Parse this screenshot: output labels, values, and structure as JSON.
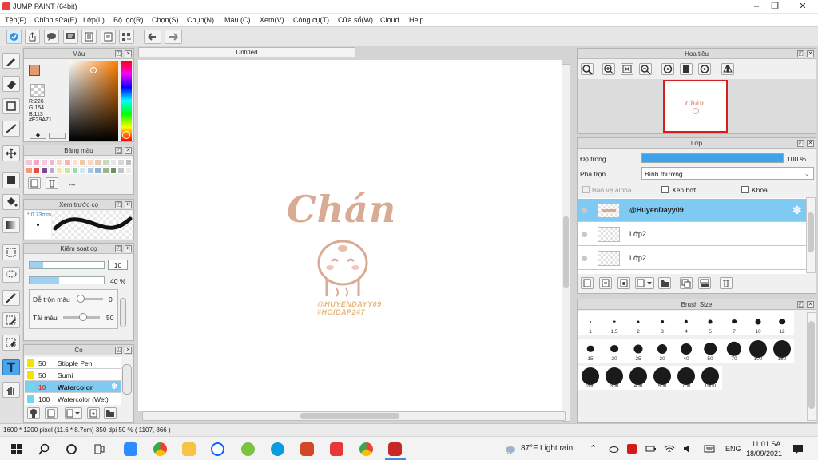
{
  "window": {
    "title": "JUMP PAINT (64bit)"
  },
  "menu": [
    "Tệp(F)",
    "Chỉnh sửa(E)",
    "Lớp(L)",
    "Bộ lọc(R)",
    "Chọn(S)",
    "Chụp(N)",
    "Màu (C)",
    "Xem(V)",
    "Công cụ(T)",
    "Cửa sổ(W)",
    "Cloud",
    "Help"
  ],
  "document": {
    "tab": "Untitled"
  },
  "color_panel": {
    "title": "Màu",
    "r": "R:226",
    "g": "G:154",
    "b": "B:113",
    "hex": "#E29A71",
    "main_color": "#e29a71"
  },
  "swatch_panel": {
    "title": "Bảng màu",
    "name": "---"
  },
  "brush_preview": {
    "title": "Xem trước cọ",
    "size": "* 0.73mm"
  },
  "brush_control": {
    "title": "Kiểm soát cọ",
    "size_value": "10",
    "opacity_value": "40 %",
    "opacity": 0.4,
    "blend_label": "Dễ trộn màu",
    "blend_value": "0",
    "reload_label": "Tải màu",
    "reload_value": "50"
  },
  "brushes": {
    "title": "Cọ",
    "items": [
      {
        "size": "50",
        "name": "Stipple Pen",
        "color": "#f1e20a"
      },
      {
        "size": "50",
        "name": "Sumi",
        "color": "#f1e20a"
      },
      {
        "size": "10",
        "name": "Watercolor",
        "color": "#6fd7f0"
      },
      {
        "size": "100",
        "name": "Watercolor (Wet)",
        "color": "#6fd7f0"
      }
    ]
  },
  "artwork": {
    "title_text": "Chán",
    "watermark1": "@HUYENDAYY09",
    "watermark2": "#HOIDAP247"
  },
  "navigator": {
    "title": "Hoa tiêu"
  },
  "layer_panel": {
    "title": "Lớp",
    "opacity_label": "Độ trong",
    "opacity_value": "100 %",
    "opacity": 1.0,
    "blend_label": "Pha trộn",
    "blend_value": "Bình thường",
    "protect_alpha": "Bảo vệ alpha",
    "clipping": "Xén bớt",
    "lock": "Khóa",
    "layers": [
      {
        "name": "@HuyenDayy09",
        "selected": true
      },
      {
        "name": "Lớp2",
        "selected": false
      },
      {
        "name": "Lớp2",
        "selected": false
      }
    ]
  },
  "brush_size_panel": {
    "title": "Brush Size",
    "sizes": [
      "1",
      "1.5",
      "2",
      "3",
      "4",
      "5",
      "7",
      "10",
      "12",
      "15",
      "20",
      "25",
      "30",
      "40",
      "50",
      "70",
      "100",
      "150",
      "200",
      "300",
      "400",
      "500",
      "700",
      "1000"
    ]
  },
  "status": {
    "text": "1600 * 1200 pixel   (11.6 * 8.7cm)   350 dpi   50 %   ( 1107, 866 )"
  },
  "taskbar": {
    "weather": "87°F  Light rain",
    "lang": "ENG",
    "time": "11:01 SA",
    "date": "18/09/2021"
  }
}
